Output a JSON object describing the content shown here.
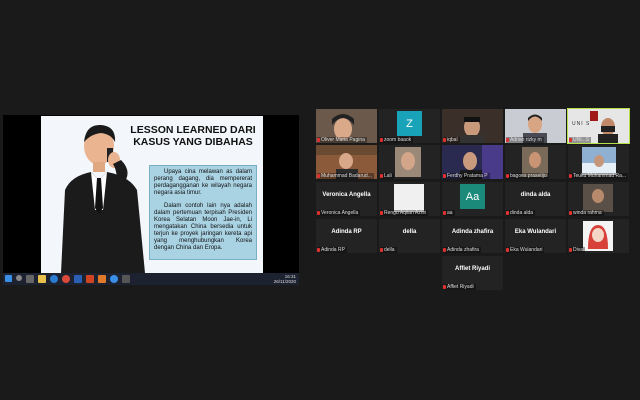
{
  "slide": {
    "title": "LESSON LEARNED DARI KASUS YANG DIBAHAS",
    "para1": "Upaya cina melawan as dalam perang dagang, dia mempererat perdagangganan ke wilayah negara negara asia timur.",
    "para2": "Dalam contoh lain nya adalah dalam pertemuan terpisah Presiden Korea Selatan Moon Jae-in, Li mengatakan China bersedia untuk terjun ke proyek jaringan kereta api yang menghubungkan Korea dengan China dan Eropa."
  },
  "taskbar": {
    "time": "16:31",
    "date": "26/11/2020"
  },
  "participants": [
    {
      "name": "Oliver Maria Pagina"
    },
    {
      "name": "zoom baaok",
      "initial": "Z"
    },
    {
      "name": "iqbal"
    },
    {
      "name": "Adrian rizky m"
    },
    {
      "name": "UNI...S",
      "overlay": "UNI  S"
    },
    {
      "name": "Muhammad Badarud..."
    },
    {
      "name": "Lali"
    },
    {
      "name": "Ferdhy Pratama P"
    },
    {
      "name": "bagoes prasetijo"
    },
    {
      "name": "Teuku Muhammad Ra..."
    },
    {
      "name": "Veronica Angella",
      "center": "Veronica Angella"
    },
    {
      "name": "Rengu Aqilan Azhri"
    },
    {
      "name": "aa",
      "initial": "Aa"
    },
    {
      "name": "dinda alda",
      "center": "dinda alda"
    },
    {
      "name": "winda rahma"
    },
    {
      "name": "Adinda RP",
      "center": "Adinda RP"
    },
    {
      "name": "della",
      "center": "della"
    },
    {
      "name": "Adinda zhafira",
      "center": "Adinda zhafira"
    },
    {
      "name": "Eka Wulandari",
      "center": "Eka Wulandari"
    },
    {
      "name": "Diva"
    },
    {
      "name": "Affiet Riyadi",
      "center": "Affiet Riyadi"
    }
  ]
}
